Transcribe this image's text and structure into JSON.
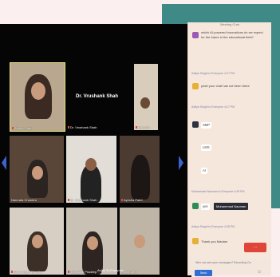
{
  "chat": {
    "title": "Meeting Chat",
    "messages": [
      {
        "sender": "",
        "time": "",
        "text": "which AI-powered innovations do we expect for the future in the educational field?"
      },
      {
        "sender": "Aditya Singhi to Everyone",
        "time": "4:27 PM",
        "text": "yeah your chat has not been there"
      },
      {
        "sender": "Aditya Singhi to Everyone",
        "time": "4:27 PM",
        "text": "SMP"
      },
      {
        "sender": "",
        "time": "",
        "text": "LMS"
      },
      {
        "sender": "",
        "time": "",
        "text": "AI"
      },
      {
        "sender": "Muhammad Nauman to Everyone",
        "time": "4:28 PM",
        "text": "yes"
      },
      {
        "sender": "Aditya Singhi to Everyone",
        "time": "4:28 PM",
        "text": "Thank you Madam"
      }
    ],
    "tooltip": "Muhammad Nauman",
    "footer_note": "Who can see your messages? Recording On",
    "send_label": "Send",
    "more_label": "..."
  },
  "video": {
    "speaker_name": "Dr. Vrushank Shah",
    "tiles": [
      {
        "label": "Aditya Singhi"
      },
      {
        "label": "Dr. Vrushank Shah"
      },
      {
        "label": "Neo Gill"
      },
      {
        "label": "Ashwin Shetty"
      },
      {
        "label": "Namrata Chandra"
      },
      {
        "label": "Dr. Vrushank Shah"
      },
      {
        "label": "Ayesha Patel"
      },
      {
        "label": "Shalvangee Bandha"
      },
      {
        "label": "Thalakkal Pradeep"
      },
      {
        "label": "Anjali To Everyone"
      },
      {
        "label": "Ravi Kumar"
      }
    ]
  },
  "colors": {
    "accent": "#2f6fd4",
    "teal": "#3f8a86",
    "unmute_red": "#e0453a"
  }
}
